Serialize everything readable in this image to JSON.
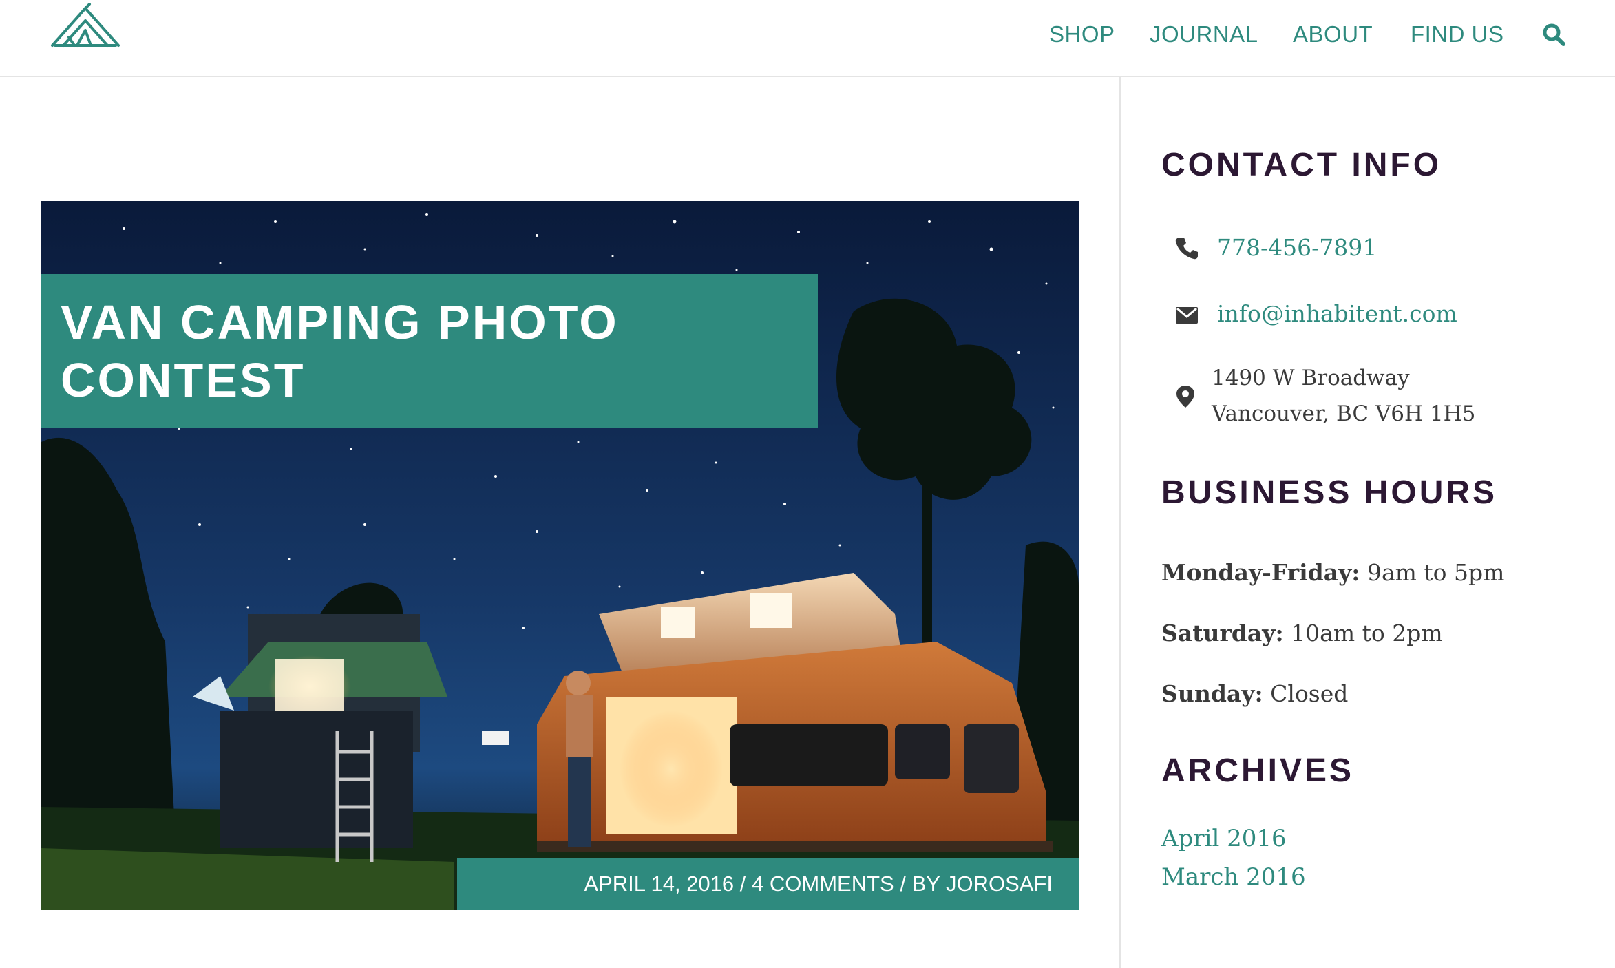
{
  "nav": {
    "items": [
      "SHOP",
      "JOURNAL",
      "ABOUT",
      "FIND US"
    ]
  },
  "post": {
    "title_line1": "VAN CAMPING PHOTO",
    "title_line2": "CONTEST",
    "date": "APRIL 14, 2016",
    "comments": "4 COMMENTS",
    "author": "BY JOROSAFI",
    "separator": "/"
  },
  "sidebar": {
    "contact_heading": "CONTACT INFO",
    "phone": "778-456-7891",
    "email": "info@inhabitent.com",
    "address_line1": "1490 W Broadway",
    "address_line2": "Vancouver, BC V6H 1H5",
    "hours_heading": "BUSINESS HOURS",
    "hours": [
      {
        "day": "Monday-Friday:",
        "time": "9am to 5pm"
      },
      {
        "day": "Saturday:",
        "time": "10am to 2pm"
      },
      {
        "day": "Sunday:",
        "time": "Closed"
      }
    ],
    "archives_heading": "ARCHIVES",
    "archives": [
      "April 2016",
      "March 2016"
    ]
  },
  "colors": {
    "accent": "#2e8a7e",
    "heading": "#2c1833",
    "body_text": "#3a3a3a"
  },
  "icons": [
    "tent-logo-icon",
    "search-icon",
    "phone-icon",
    "envelope-icon",
    "map-marker-icon"
  ]
}
